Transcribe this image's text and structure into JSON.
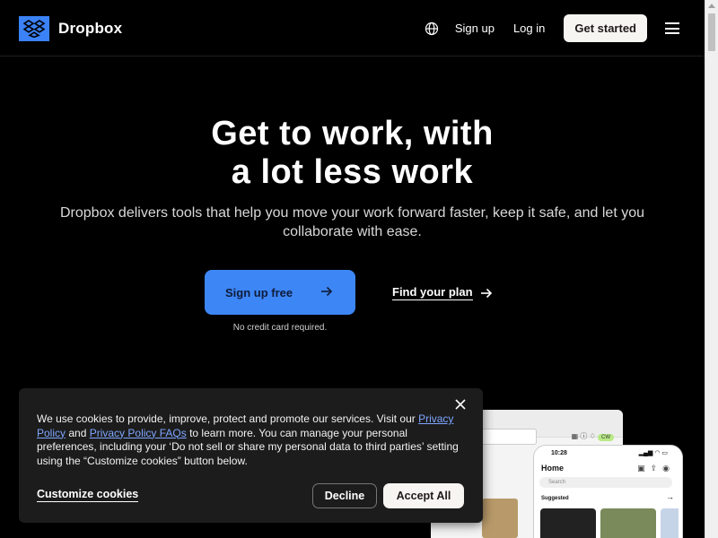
{
  "brand": {
    "name": "Dropbox",
    "accent": "#3d86f6"
  },
  "header": {
    "globe_icon": "globe-icon",
    "signup": "Sign up",
    "login": "Log in",
    "get_started": "Get started",
    "menu_icon": "hamburger-menu-icon"
  },
  "hero": {
    "title_line1": "Get to work, with",
    "title_line2": "a lot less work",
    "subtitle": "Dropbox delivers tools that help you move your work forward faster, keep it safe, and let you collaborate with ease.",
    "primary_cta": "Sign up free",
    "secondary_cta": "Find your plan",
    "note": "No credit card required."
  },
  "preview": {
    "desktop_avatar": "CW",
    "phone": {
      "time": "10:28",
      "home": "Home",
      "search_placeholder": "Search",
      "suggested": "Suggested"
    }
  },
  "cookie": {
    "text_before": "We use cookies to provide, improve, protect and promote our services. Visit our ",
    "link1": "Privacy Policy",
    "text_and": " and ",
    "link2": "Privacy Policy FAQs",
    "text_after": " to learn more. You can manage your personal preferences, including your ‘Do not sell or share my personal data to third parties’ setting using the “Customize cookies” button below.",
    "customize": "Customize cookies",
    "decline": "Decline",
    "accept": "Accept All"
  }
}
